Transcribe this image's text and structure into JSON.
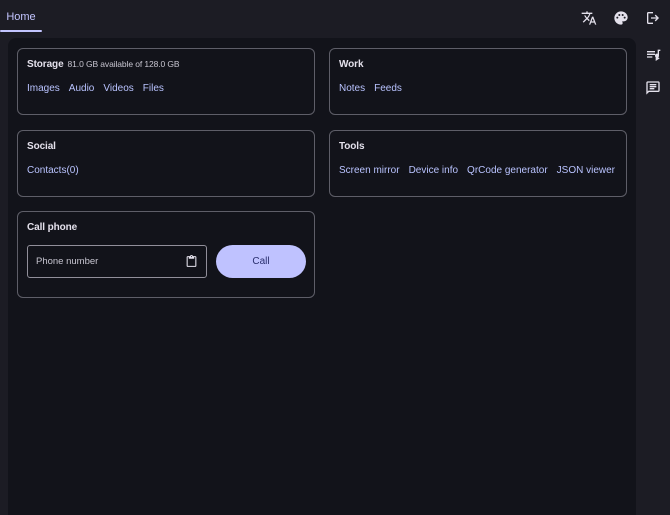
{
  "header": {
    "tabs": [
      {
        "label": "Home"
      }
    ],
    "icons": [
      "translate-icon",
      "palette-icon",
      "logout-icon"
    ]
  },
  "storage": {
    "title": "Storage",
    "subtitle": "81.0 GB available of 128.0 GB",
    "links": [
      "Images",
      "Audio",
      "Videos",
      "Files"
    ]
  },
  "work": {
    "title": "Work",
    "links": [
      "Notes",
      "Feeds"
    ]
  },
  "social": {
    "title": "Social",
    "links": [
      "Contacts(0)"
    ]
  },
  "tools": {
    "title": "Tools",
    "links": [
      "Screen mirror",
      "Device info",
      "QrCode generator",
      "JSON viewer"
    ]
  },
  "call_phone": {
    "title": "Call phone",
    "placeholder": "Phone number",
    "button_label": "Call"
  },
  "rail": {
    "icons": [
      "playlist-icon",
      "chat-icon"
    ]
  },
  "colors": {
    "accent": "#c3c5ff",
    "background": "#12131a",
    "link": "#b9c3ff",
    "button": "#bfc2ff"
  }
}
